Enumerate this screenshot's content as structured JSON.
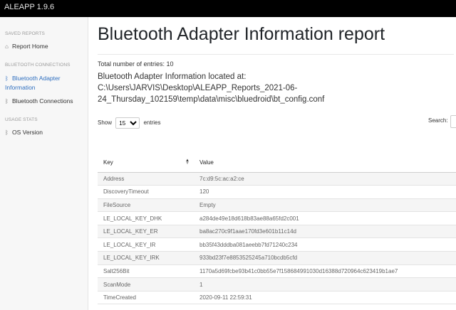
{
  "app": {
    "brand": "ALEAPP 1.9.6"
  },
  "sidebar": {
    "sections": [
      {
        "heading": "SAVED REPORTS",
        "items": [
          {
            "label": "Report Home",
            "icon": "home-icon"
          }
        ]
      },
      {
        "heading": "BLUETOOTH CONNECTIONS",
        "items": [
          {
            "label": "Bluetooth Adapter Information",
            "icon": "bluetooth-icon",
            "active": true
          },
          {
            "label": "Bluetooth Connections",
            "icon": "bluetooth-icon"
          }
        ]
      },
      {
        "heading": "USAGE STATS",
        "items": [
          {
            "label": "OS Version",
            "icon": "bluetooth-icon"
          }
        ]
      }
    ]
  },
  "main": {
    "title": "Bluetooth Adapter Information report",
    "total_entries": "Total number of entries: 10",
    "location": "Bluetooth Adapter Information located at: C:\\Users\\JARVIS\\Desktop\\ALEAPP_Reports_2021-06-24_Thursday_102159\\temp\\data\\misc\\bluedroid\\bt_config.conf"
  },
  "controls": {
    "show_label": "Show",
    "entries_value": "15",
    "entries_label": "entries",
    "search_label": "Search:"
  },
  "table": {
    "columns": [
      "Key",
      "Value"
    ],
    "rows": [
      [
        "Address",
        "7c:d9:5c:ac:a2:ce"
      ],
      [
        "DiscoveryTimeout",
        "120"
      ],
      [
        "FileSource",
        "Empty"
      ],
      [
        "LE_LOCAL_KEY_DHK",
        "a284de49e18d618b83ae88a65fd2c001"
      ],
      [
        "LE_LOCAL_KEY_ER",
        "ba8ac270c9f1aae170fd3e601b11c14d"
      ],
      [
        "LE_LOCAL_KEY_IR",
        "bb35f43dddba081aeebb7fd71240c234"
      ],
      [
        "LE_LOCAL_KEY_IRK",
        "933bd23f7e8853525245a710bcdb5cfd"
      ],
      [
        "Salt256Bit",
        "1170a5d69fcbe93b41c0bb55e7f158684991030d16388d720964c623419b1ae7"
      ],
      [
        "ScanMode",
        "1"
      ],
      [
        "TimeCreated",
        "2020-09-11 22:59:31"
      ]
    ]
  }
}
